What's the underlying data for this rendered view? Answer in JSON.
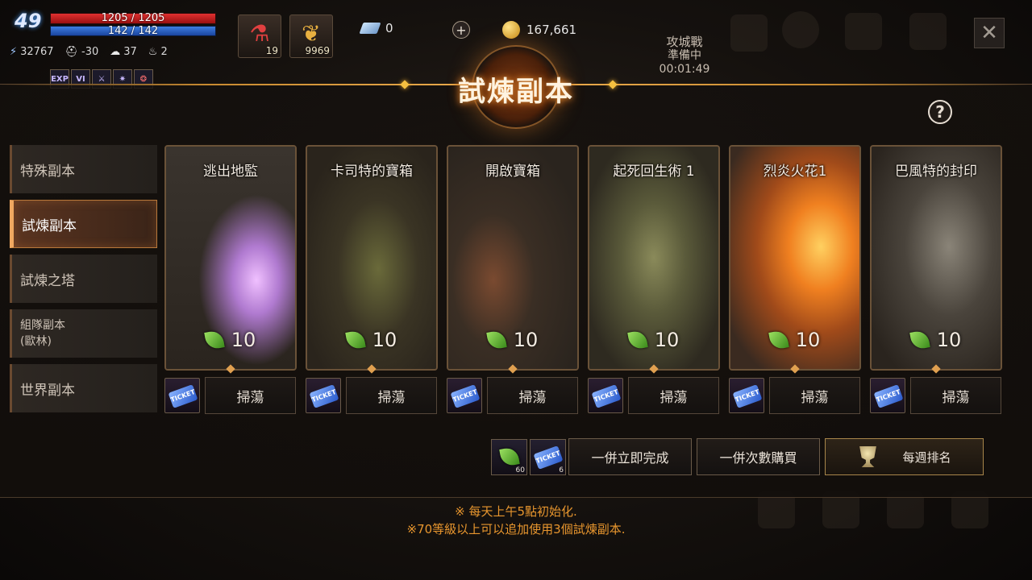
{
  "player": {
    "level": "49",
    "hp": "1205 / 1205",
    "mp": "142 / 142",
    "power": "32767",
    "stat_a": "-30",
    "stat_b": "37",
    "stat_c": "2",
    "buffs": [
      "EXP",
      "VI",
      "",
      "",
      ""
    ]
  },
  "items": [
    {
      "icon": "potion-icon",
      "glyph": "⚗",
      "count": "19"
    },
    {
      "icon": "feather-icon",
      "glyph": "❦",
      "count": "9969"
    }
  ],
  "currency": {
    "diamonds": "0",
    "gold": "167,661",
    "plus": "+"
  },
  "siege": {
    "title": "攻城戰",
    "status": "準備中",
    "timer": "00:01:49"
  },
  "dialog": {
    "title": "試煉副本",
    "help": "?"
  },
  "sidebar": {
    "items": [
      {
        "label": "特殊副本",
        "active": false
      },
      {
        "label": "試煉副本",
        "active": true
      },
      {
        "label": "試煉之塔",
        "active": false
      },
      {
        "label": "組隊副本\n(歐林)",
        "active": false
      },
      {
        "label": "世界副本",
        "active": false
      }
    ]
  },
  "dungeons": [
    {
      "name": "逃出地監",
      "cost": "10",
      "sweep": "掃蕩"
    },
    {
      "name": "卡司特的寶箱",
      "cost": "10",
      "sweep": "掃蕩"
    },
    {
      "name": "開啟寶箱",
      "cost": "10",
      "sweep": "掃蕩"
    },
    {
      "name": "起死回生術 1",
      "cost": "10",
      "sweep": "掃蕩"
    },
    {
      "name": "烈炎火花1",
      "cost": "10",
      "sweep": "掃蕩"
    },
    {
      "name": "巴風特的封印",
      "cost": "10",
      "sweep": "掃蕩"
    }
  ],
  "actions": {
    "leaf_count": "60",
    "ticket_count": "6",
    "complete_all": "一併立即完成",
    "buy_all": "一併次數購買",
    "weekly_rank": "每週排名"
  },
  "notes": [
    "※ 每天上午5點初始化.",
    "※70等級以上可以追加使用3個試煉副本."
  ],
  "colors": {
    "accent": "#f0a860",
    "note": "#e8962e",
    "title_glow": "#e08a30"
  }
}
